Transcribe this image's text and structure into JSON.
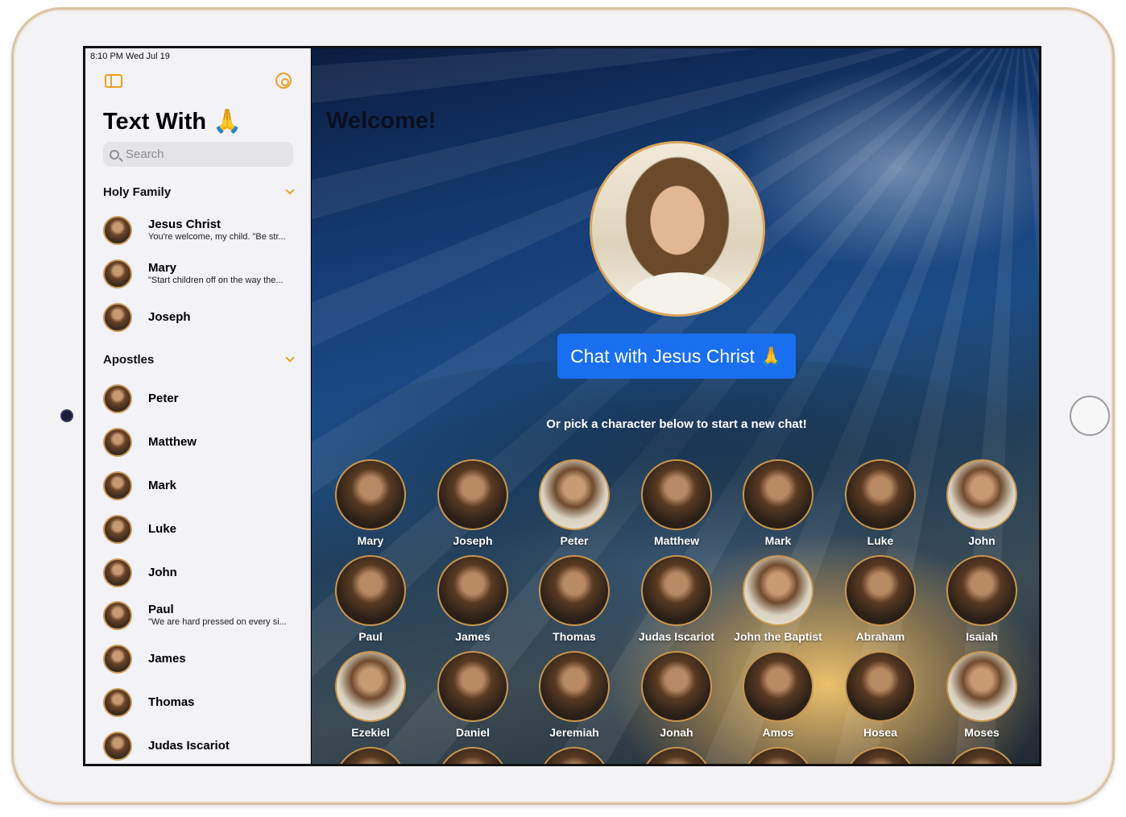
{
  "status_bar": {
    "time": "8:10 PM   Wed Jul 19"
  },
  "sidebar": {
    "title": "Text With 🙏",
    "search_placeholder": "Search",
    "sections": [
      {
        "label": "Holy Family",
        "items": [
          {
            "name": "Jesus Christ",
            "preview": "You're welcome, my child. \"Be str..."
          },
          {
            "name": "Mary",
            "preview": "\"Start children off on the way the..."
          },
          {
            "name": "Joseph",
            "preview": ""
          }
        ]
      },
      {
        "label": "Apostles",
        "items": [
          {
            "name": "Peter",
            "preview": ""
          },
          {
            "name": "Matthew",
            "preview": ""
          },
          {
            "name": "Mark",
            "preview": ""
          },
          {
            "name": "Luke",
            "preview": ""
          },
          {
            "name": "John",
            "preview": ""
          },
          {
            "name": "Paul",
            "preview": "\"We are hard pressed on every si..."
          },
          {
            "name": "James",
            "preview": ""
          },
          {
            "name": "Thomas",
            "preview": ""
          },
          {
            "name": "Judas Iscariot",
            "preview": ""
          }
        ]
      }
    ]
  },
  "main": {
    "welcome": "Welcome!",
    "chat_button": "Chat with Jesus Christ 🙏",
    "pick_text": "Or pick a character below to start a new chat!",
    "characters": [
      "Mary",
      "Joseph",
      "Peter",
      "Matthew",
      "Mark",
      "Luke",
      "John",
      "Paul",
      "James",
      "Thomas",
      "Judas Iscariot",
      "John the Baptist",
      "Abraham",
      "Isaiah",
      "Ezekiel",
      "Daniel",
      "Jeremiah",
      "Jonah",
      "Amos",
      "Hosea",
      "Moses"
    ]
  },
  "colors": {
    "accent": "#f0a020",
    "button": "#1a6ff0"
  }
}
